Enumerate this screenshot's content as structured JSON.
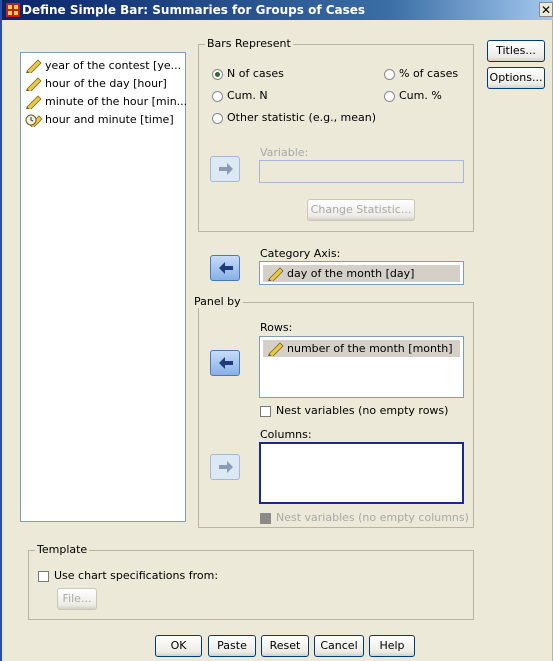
{
  "window": {
    "title": "Define Simple Bar: Summaries for Groups of Cases",
    "close_glyph": "✕"
  },
  "variables": [
    "year of the contest [ye...",
    "hour of the day [hour]",
    "minute of the hour [min...",
    "hour and minute [time]"
  ],
  "bars_represent": {
    "label": "Bars Represent",
    "options": {
      "n_of_cases": "N of cases",
      "pct_of_cases": "% of cases",
      "cum_n": "Cum. N",
      "cum_pct": "Cum. %",
      "other": "Other statistic (e.g., mean)"
    },
    "selected": "N of cases",
    "variable_label": "Variable:",
    "variable_value": "",
    "change_statistic": "Change Statistic..."
  },
  "category_axis": {
    "label": "Category Axis:",
    "value": "day of the month [day]"
  },
  "panel_by": {
    "label": "Panel by",
    "rows_label": "Rows:",
    "rows_value": "number of the month [month]",
    "nest_rows": "Nest variables (no empty rows)",
    "columns_label": "Columns:",
    "columns_value": "",
    "nest_columns": "Nest variables (no empty columns)"
  },
  "template": {
    "label": "Template",
    "use_spec": "Use chart specifications from:",
    "file_button": "File..."
  },
  "side_buttons": {
    "titles": "Titles...",
    "options": "Options..."
  },
  "bottom_buttons": {
    "ok": "OK",
    "paste": "Paste",
    "reset": "Reset",
    "cancel": "Cancel",
    "help": "Help"
  },
  "icons": {
    "scale_var": "ruler-pencil-icon",
    "time_var": "clock-ruler-icon",
    "arrow": "arrow-icon"
  },
  "colors": {
    "title_bar": "#0a246a",
    "dialog_bg": "#ece9d8",
    "arrow_active": "#88b0e6"
  }
}
